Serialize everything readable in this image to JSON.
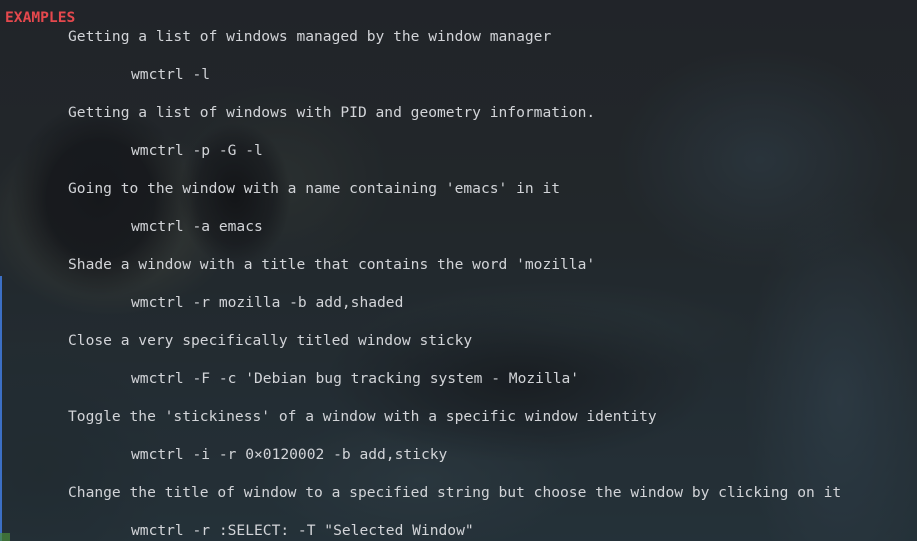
{
  "terminal": {
    "section_heading": "EXAMPLES",
    "examples": [
      {
        "description": "Getting a list of windows managed by the window manager",
        "command": "wmctrl -l"
      },
      {
        "description": "Getting a list of windows with PID and geometry information.",
        "command": "wmctrl -p -G -l"
      },
      {
        "description": "Going to the window with a name containing 'emacs' in it",
        "command": "wmctrl -a emacs"
      },
      {
        "description": "Shade a window with a title that contains the word 'mozilla'",
        "command": "wmctrl -r mozilla -b add,shaded"
      },
      {
        "description": "Close a very specifically titled window sticky",
        "command": "wmctrl -F -c 'Debian bug tracking system - Mozilla'"
      },
      {
        "description": "Toggle the 'stickiness' of a window with a specific window identity",
        "command": "wmctrl -i -r 0×0120002 -b add,sticky"
      },
      {
        "description": "Change the title of window to a specified string but choose the window by clicking on it",
        "command": "wmctrl -r :SELECT: -T \"Selected Window\""
      }
    ]
  },
  "colors": {
    "heading": "#e5484d",
    "text": "#d2d4d8"
  }
}
